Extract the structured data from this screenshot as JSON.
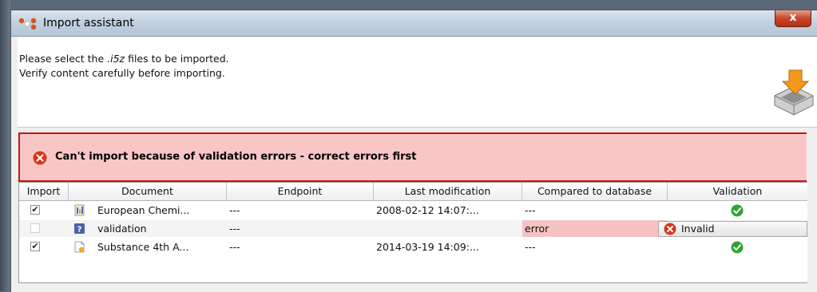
{
  "window": {
    "title": "Import assistant",
    "close_label": "x"
  },
  "header": {
    "line1_before": "Please select the ",
    "line1_emph": ".i5z",
    "line1_after": " files to be imported.",
    "line2": "Verify content carefully before importing."
  },
  "banner": {
    "message": "Can't import because of validation errors - correct errors first"
  },
  "table": {
    "columns": [
      "Import",
      "Document",
      "Endpoint",
      "Last modification",
      "Compared to database",
      "Validation"
    ],
    "rows": [
      {
        "checked": "✔",
        "document": "European Chemi...",
        "endpoint": "---",
        "last_modification": "2008-02-12 14:07:...",
        "compared": "---",
        "validation": ""
      },
      {
        "checked": "",
        "document": "validation",
        "endpoint": "---",
        "last_modification": "",
        "compared": "error",
        "validation": "Invalid"
      },
      {
        "checked": "✔",
        "document": "Substance 4th A...",
        "endpoint": "---",
        "last_modification": "2014-03-19 14:09:...",
        "compared": "---",
        "validation": ""
      }
    ]
  },
  "colors": {
    "error_bg": "#f9c6c6",
    "error_border": "#c61414",
    "ok_green": "#2fa52f"
  },
  "icons": {
    "app": "app-logo-icon",
    "import": "import-tray-icon",
    "error": "error-x-icon",
    "valid": "valid-check-icon",
    "doc_chem": "chemical-doc-icon",
    "doc_unknown": "unknown-doc-icon",
    "doc_substance": "substance-doc-icon"
  }
}
